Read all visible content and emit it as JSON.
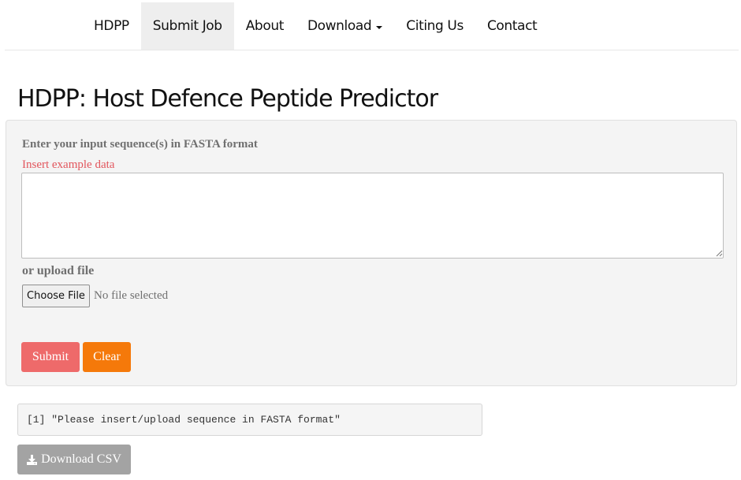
{
  "navbar": {
    "items": [
      {
        "label": "HDPP",
        "active": false
      },
      {
        "label": "Submit Job",
        "active": true
      },
      {
        "label": "About",
        "active": false
      },
      {
        "label": "Download",
        "active": false,
        "dropdown": true
      },
      {
        "label": "Citing Us",
        "active": false
      },
      {
        "label": "Contact",
        "active": false
      }
    ]
  },
  "page": {
    "title": "HDPP: Host Defence Peptide Predictor"
  },
  "form": {
    "input_label": "Enter your input sequence(s) in FASTA format",
    "example_link": "Insert example data",
    "textarea_value": "",
    "upload_label": "or upload file",
    "choose_file_label": "Choose File",
    "no_file_text": "No file selected",
    "submit_label": "Submit",
    "clear_label": "Clear"
  },
  "output": {
    "message": "[1] \"Please insert/upload sequence in FASTA format\"",
    "download_label": "Download CSV",
    "download_icon": "download-icon"
  },
  "colors": {
    "submit": "#ee6a6a",
    "clear": "#f5790a",
    "download": "#a3a3a3",
    "example_link": "#e2555c"
  }
}
